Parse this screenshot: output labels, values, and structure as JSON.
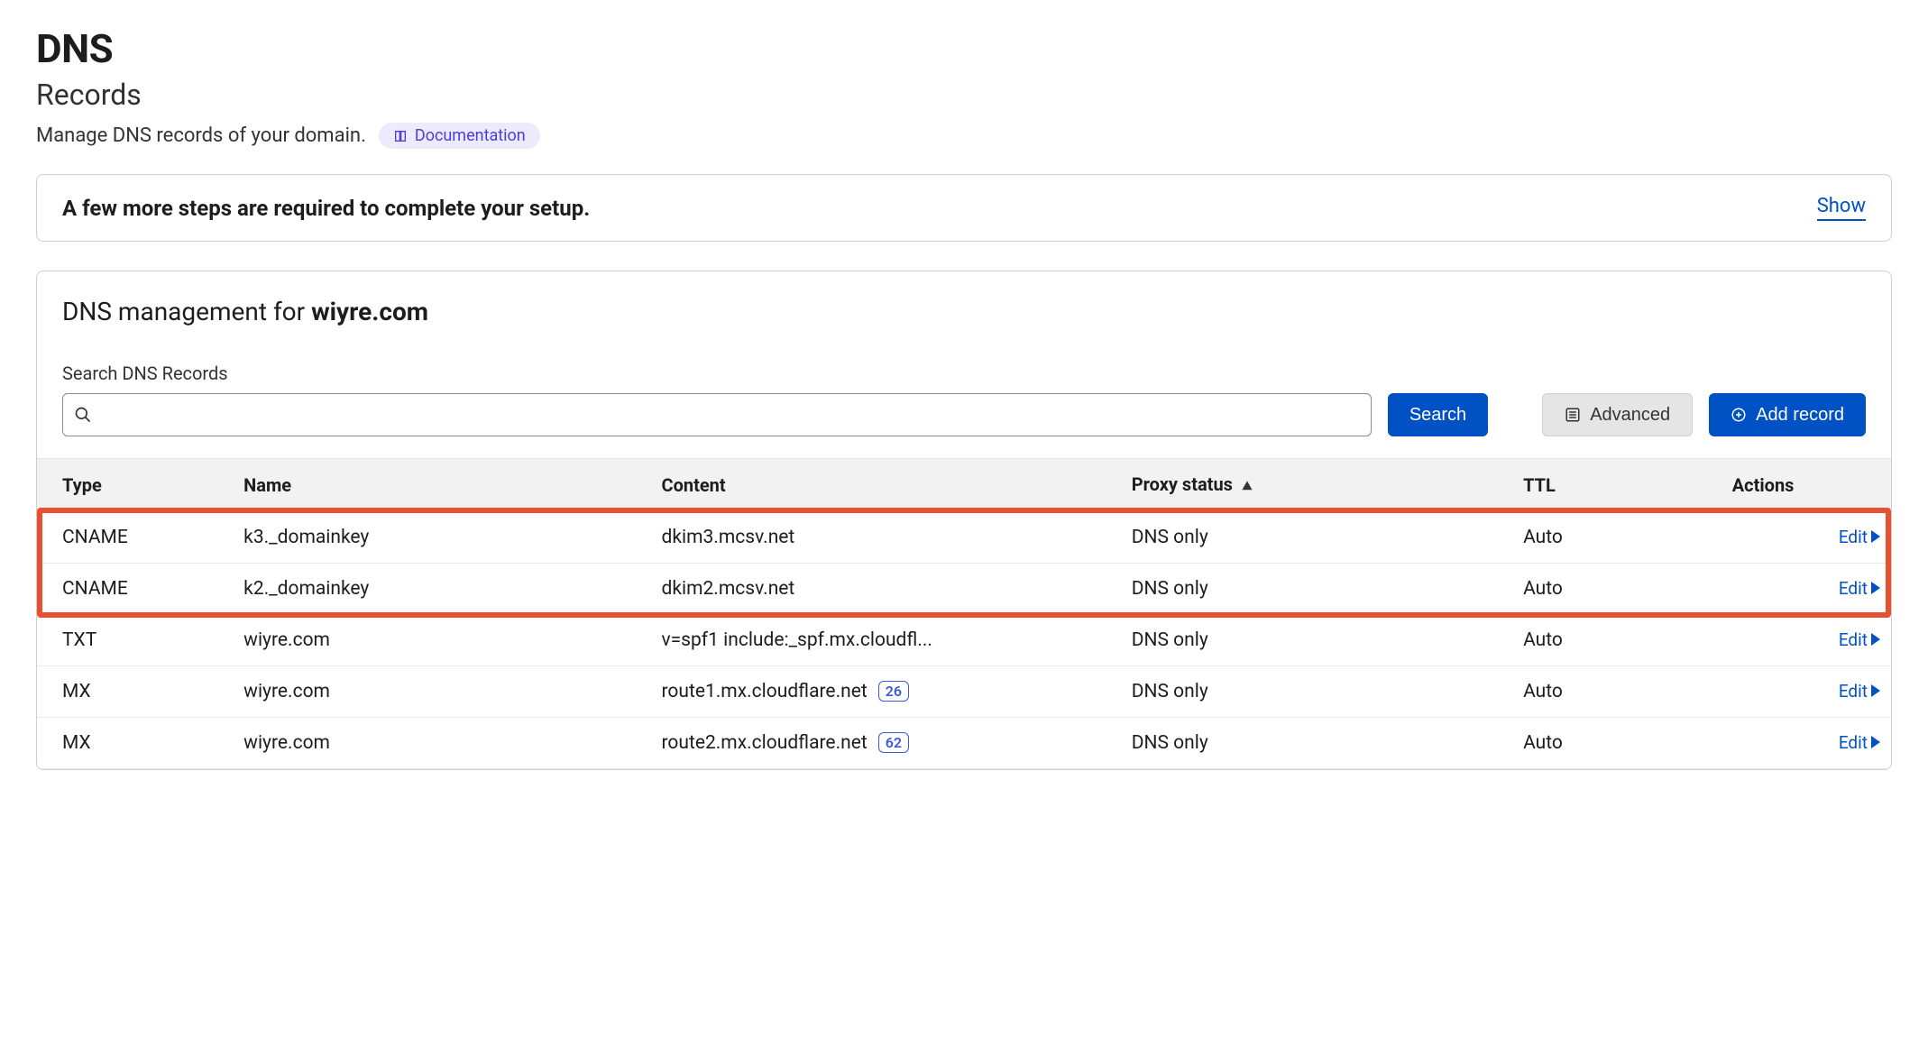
{
  "header": {
    "title": "DNS",
    "subtitle": "Records",
    "description": "Manage DNS records of your domain.",
    "documentation_label": "Documentation"
  },
  "banner": {
    "text": "A few more steps are required to complete your setup.",
    "show_label": "Show"
  },
  "panel": {
    "title_prefix": "DNS management for ",
    "domain": "wiyre.com",
    "search_label": "Search DNS Records",
    "search_placeholder": "",
    "search_button": "Search",
    "advanced_button": "Advanced",
    "add_record_button": "Add record"
  },
  "table": {
    "columns": {
      "type": "Type",
      "name": "Name",
      "content": "Content",
      "proxy": "Proxy status",
      "ttl": "TTL",
      "actions": "Actions"
    },
    "edit_label": "Edit",
    "rows": [
      {
        "type": "CNAME",
        "name": "k3._domainkey",
        "content": "dkim3.mcsv.net",
        "priority": null,
        "proxy": "DNS only",
        "ttl": "Auto",
        "highlighted": true
      },
      {
        "type": "CNAME",
        "name": "k2._domainkey",
        "content": "dkim2.mcsv.net",
        "priority": null,
        "proxy": "DNS only",
        "ttl": "Auto",
        "highlighted": true
      },
      {
        "type": "TXT",
        "name": "wiyre.com",
        "content": "v=spf1 include:_spf.mx.cloudfl...",
        "priority": null,
        "proxy": "DNS only",
        "ttl": "Auto",
        "highlighted": false
      },
      {
        "type": "MX",
        "name": "wiyre.com",
        "content": "route1.mx.cloudflare.net",
        "priority": "26",
        "proxy": "DNS only",
        "ttl": "Auto",
        "highlighted": false
      },
      {
        "type": "MX",
        "name": "wiyre.com",
        "content": "route2.mx.cloudflare.net",
        "priority": "62",
        "proxy": "DNS only",
        "ttl": "Auto",
        "highlighted": false
      }
    ]
  }
}
